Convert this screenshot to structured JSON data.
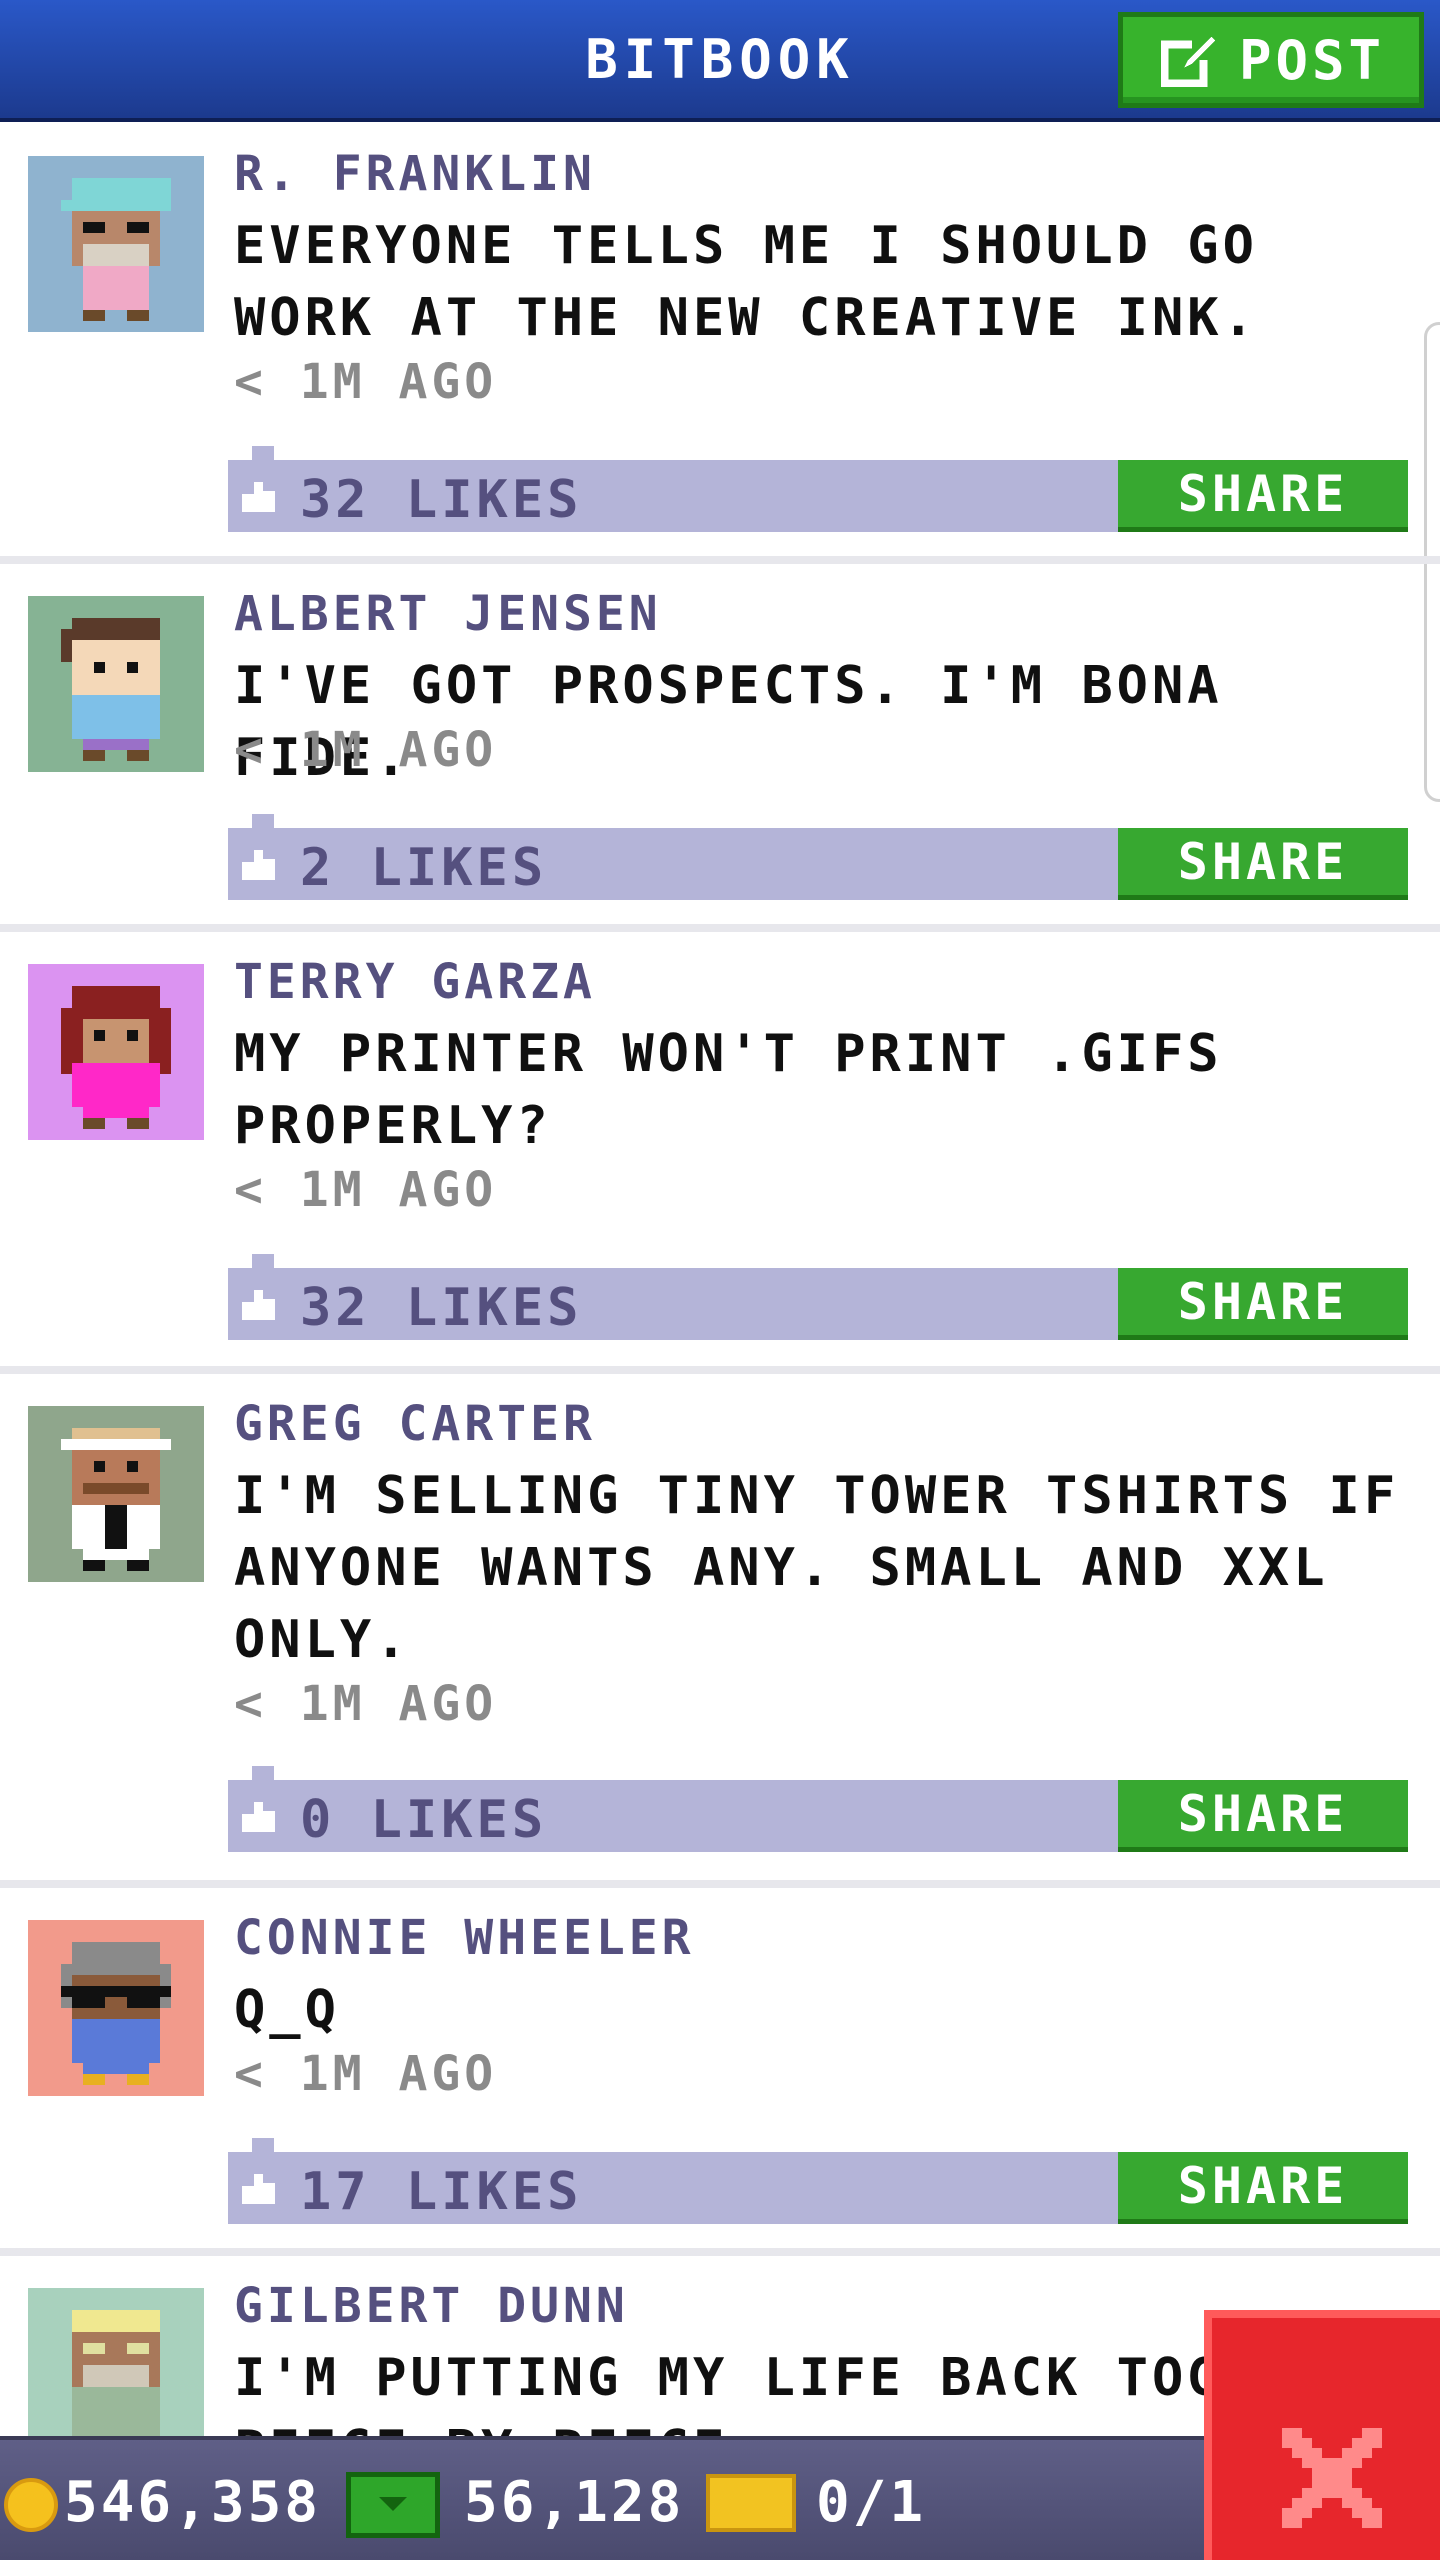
{
  "header": {
    "title": "BITBOOK",
    "post_label": "POST"
  },
  "colors": {
    "header_blue": "#1c3a8e",
    "green": "#37a830",
    "likes_bar": "#b4b4d8",
    "author_purple": "#55507f",
    "close_red": "#e7262c"
  },
  "share_label": "SHARE",
  "posts": [
    {
      "author": "R. FRANKLIN",
      "message": "EVERYONE TELLS ME I SHOULD GO WORK AT THE NEW CREATIVE INK.",
      "time": "< 1M AGO",
      "likes": "32 LIKES",
      "avatar_bg": "#8fb3cf"
    },
    {
      "author": "ALBERT JENSEN",
      "message": "I'VE GOT PROSPECTS. I'M BONA FIDE.",
      "time": "< 1M AGO",
      "likes": "2 LIKES",
      "avatar_bg": "#86b394"
    },
    {
      "author": "TERRY GARZA",
      "message": "MY PRINTER WON'T PRINT .GIFS PROPERLY?",
      "time": "< 1M AGO",
      "likes": "32 LIKES",
      "avatar_bg": "#db93f1"
    },
    {
      "author": "GREG CARTER",
      "message": "I'M SELLING TINY TOWER TSHIRTS IF ANYONE WANTS ANY. SMALL AND XXL ONLY.",
      "time": "< 1M AGO",
      "likes": "0 LIKES",
      "avatar_bg": "#8fa68c"
    },
    {
      "author": "CONNIE WHEELER",
      "message": "Q_Q",
      "time": "< 1M AGO",
      "likes": "17 LIKES",
      "avatar_bg": "#f29a8b"
    },
    {
      "author": "GILBERT DUNN",
      "message": "I'M PUTTING MY LIFE BACK TOGETHER PIECE BY PIECE",
      "time": "",
      "likes": "",
      "avatar_bg": "#a8d1bd"
    }
  ],
  "status": {
    "coins": "546,358",
    "bux": "56,128",
    "tickets": "0/1"
  }
}
